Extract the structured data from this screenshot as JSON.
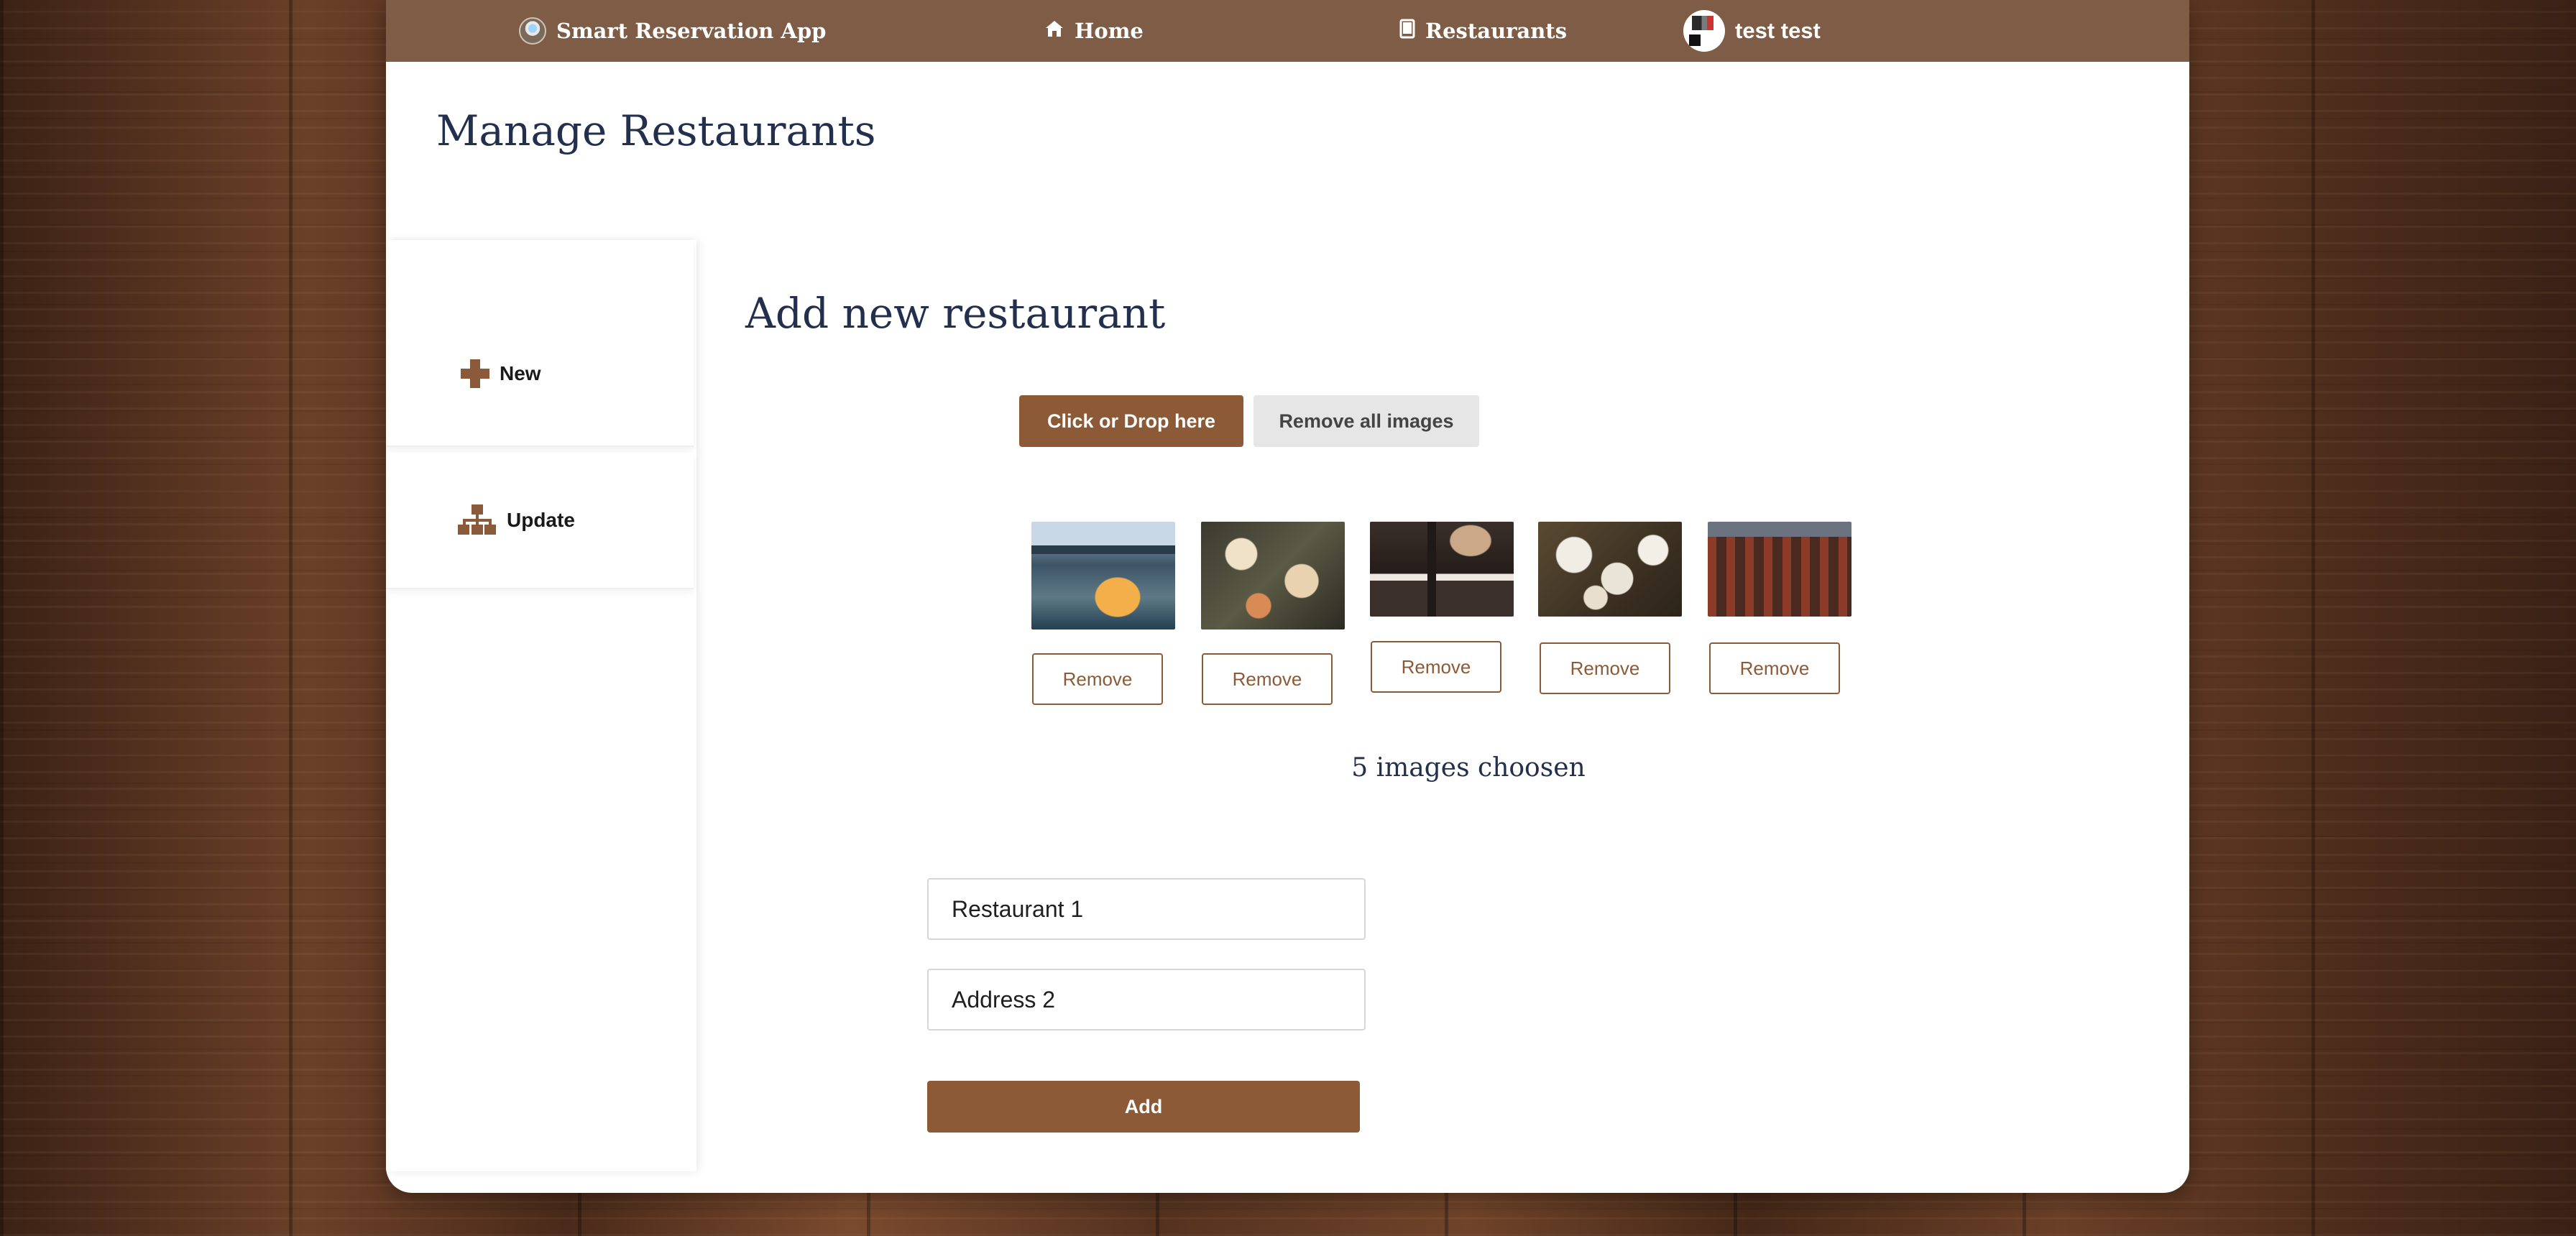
{
  "navbar": {
    "brand": "Smart Reservation App",
    "home": "Home",
    "restaurants": "Restaurants",
    "user": "test test"
  },
  "page": {
    "title": "Manage Restaurants"
  },
  "sidebar": {
    "items": [
      {
        "label": "New",
        "icon": "plus-icon"
      },
      {
        "label": "Update",
        "icon": "sitemap-icon"
      }
    ]
  },
  "form": {
    "title": "Add new restaurant",
    "drop_button": "Click or Drop here",
    "remove_all_button": "Remove all images",
    "remove_label": "Remove",
    "images_count": "5 images choosen",
    "name_value": "Restaurant 1",
    "address_value": "Address 2",
    "add_button": "Add"
  },
  "colors": {
    "navbar": "#7e5c45",
    "accent": "#8d5a37",
    "heading": "#22304e"
  }
}
